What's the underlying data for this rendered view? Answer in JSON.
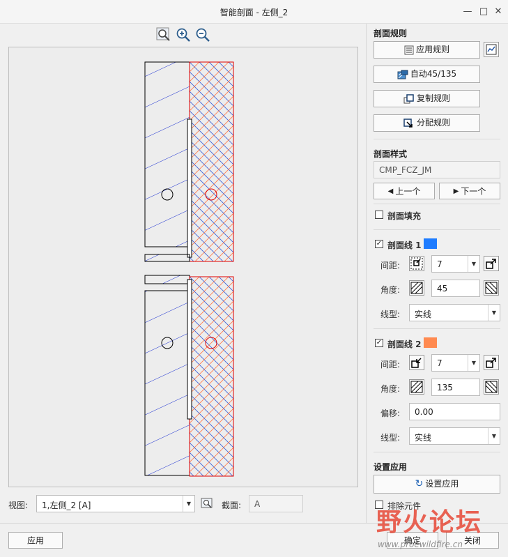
{
  "window": {
    "title": "智能剖面 - 左侧_2"
  },
  "zoom": {
    "fit_icon": "zoom-fit-icon",
    "in_icon": "zoom-in-icon",
    "out_icon": "zoom-out-icon"
  },
  "view": {
    "label": "视图:",
    "value": "1,左侧_2 [A]",
    "section_label": "截面:",
    "section_value": "A"
  },
  "rules": {
    "title": "剖面规则",
    "apply_rule": "应用规则",
    "auto_45_135": "自动45/135",
    "copy_rule": "复制规则",
    "assign_rule": "分配规则"
  },
  "style": {
    "title": "剖面样式",
    "value": "CMP_FCZ_JM",
    "prev": "上一个",
    "next": "下一个",
    "fill_label": "剖面填充",
    "fill_checked": false
  },
  "hatch1": {
    "label": "剖面线 1",
    "checked": true,
    "color": "#1e7cff",
    "spacing_label": "间距:",
    "spacing": "7",
    "angle_label": "角度:",
    "angle": "45",
    "linetype_label": "线型:",
    "linetype": "实线"
  },
  "hatch2": {
    "label": "剖面线 2",
    "checked": true,
    "color": "#ff8a50",
    "spacing_label": "间距:",
    "spacing": "7",
    "angle_label": "角度:",
    "angle": "135",
    "offset_label": "偏移:",
    "offset": "0.00",
    "linetype_label": "线型:",
    "linetype": "实线"
  },
  "apply_settings": {
    "title": "设置应用",
    "button": "设置应用",
    "exclude_label": "排除元件",
    "exclude_checked": false
  },
  "footer": {
    "apply": "应用",
    "ok": "确定",
    "close": "关闭"
  },
  "watermark": {
    "text": "野火论坛",
    "url": "www.proewildfire.cn"
  }
}
